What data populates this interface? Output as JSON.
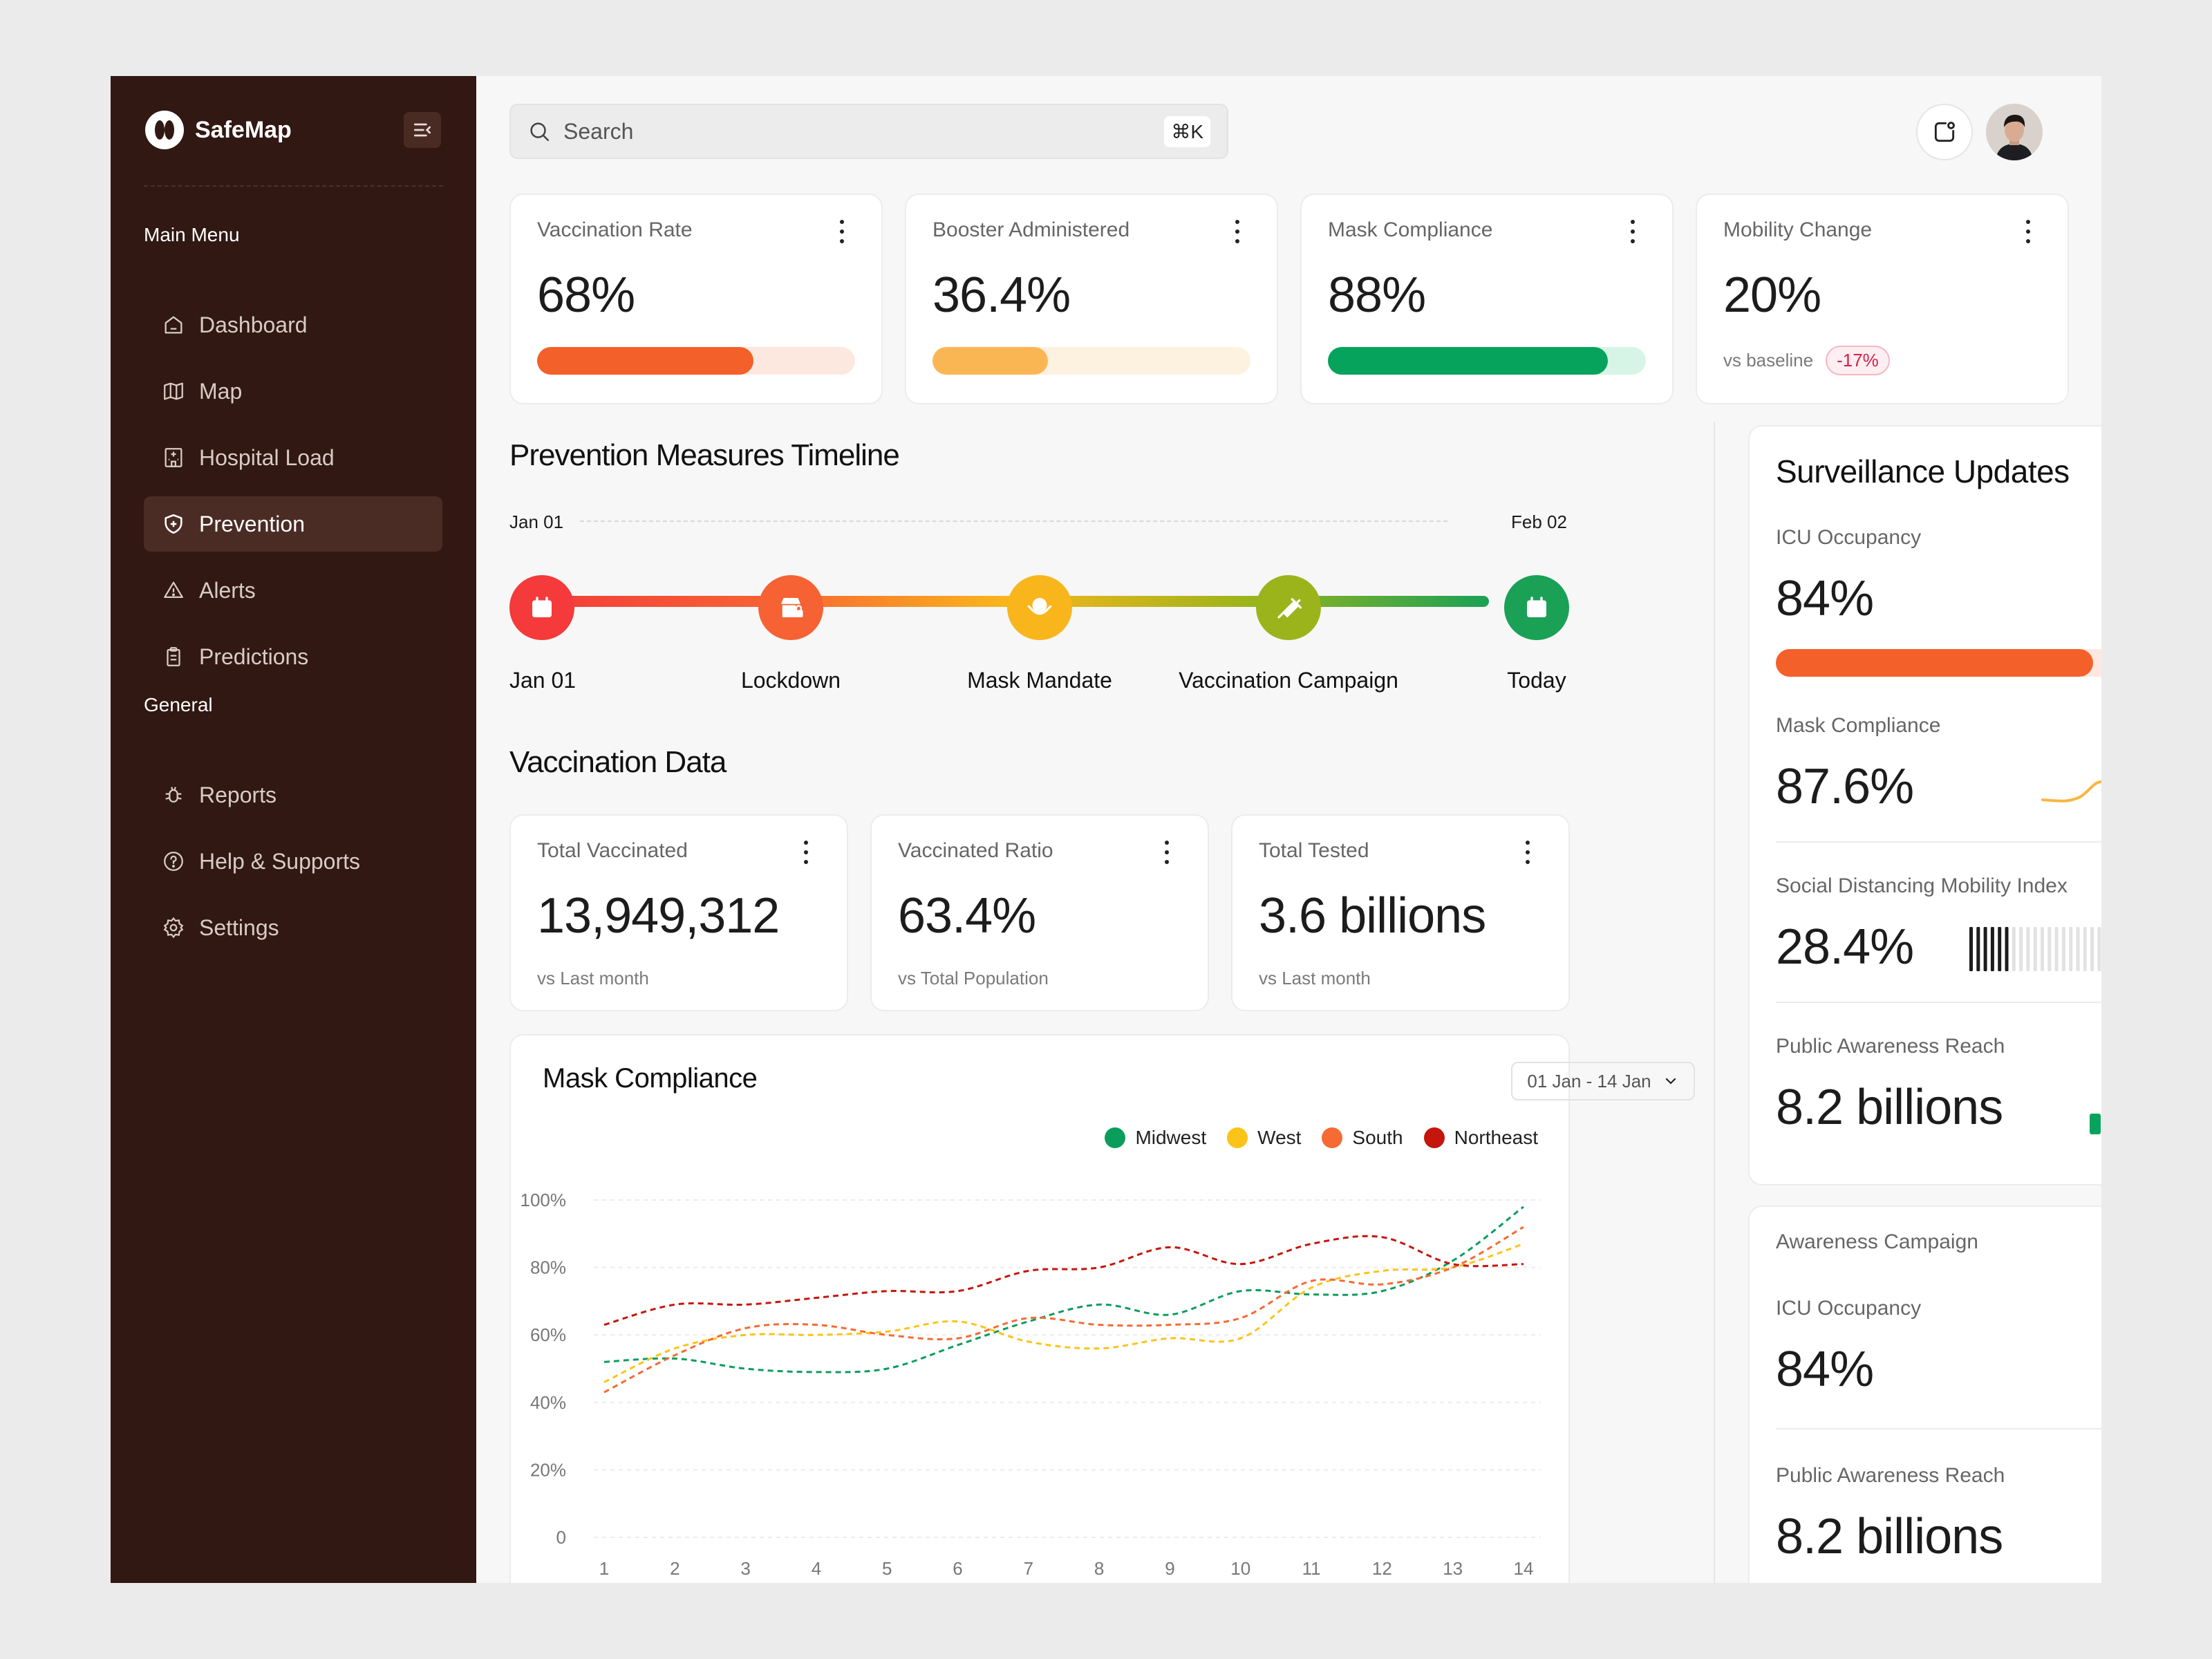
{
  "app": {
    "name": "SafeMap"
  },
  "sidebar": {
    "main_menu_label": "Main Menu",
    "main_items": [
      {
        "label": "Dashboard",
        "icon": "home-icon"
      },
      {
        "label": "Map",
        "icon": "map-icon"
      },
      {
        "label": "Hospital Load",
        "icon": "hospital-icon"
      },
      {
        "label": "Prevention",
        "icon": "shield-plus-icon",
        "active": true
      },
      {
        "label": "Alerts",
        "icon": "warning-icon"
      },
      {
        "label": "Predictions",
        "icon": "clipboard-icon"
      }
    ],
    "general_label": "General",
    "general_items": [
      {
        "label": "Reports",
        "icon": "bug-icon"
      },
      {
        "label": "Help & Supports",
        "icon": "help-icon"
      },
      {
        "label": "Settings",
        "icon": "gear-icon"
      }
    ]
  },
  "search": {
    "placeholder": "Search",
    "shortcut": "⌘K"
  },
  "stats": [
    {
      "title": "Vaccination Rate",
      "value": "68%",
      "progress": 0.68,
      "color": "#f4602a",
      "track": "#fde8df"
    },
    {
      "title": "Booster Administered",
      "value": "36.4%",
      "progress": 0.364,
      "color": "#fbb654",
      "track": "#fdf1e0"
    },
    {
      "title": "Mask Compliance",
      "value": "88%",
      "progress": 0.88,
      "color": "#05a35c",
      "track": "#d7f5e7"
    },
    {
      "title": "Mobility Change",
      "value": "20%",
      "sub": "vs baseline",
      "badge": "-17%"
    }
  ],
  "timeline": {
    "title": "Prevention Measures Timeline",
    "start_date": "Jan 01",
    "end_date": "Feb 02",
    "events": [
      {
        "label": "Jan 01",
        "color": "#f43a3a",
        "icon": "calendar-icon"
      },
      {
        "label": "Lockdown",
        "color": "#f66234",
        "icon": "store-lock-icon"
      },
      {
        "label": "Mask Mandate",
        "color": "#f8b61c",
        "icon": "mask-icon"
      },
      {
        "label": "Vaccination Campaign",
        "color": "#9cb41c",
        "icon": "syringe-icon"
      },
      {
        "label": "Today",
        "color": "#1aa156",
        "icon": "calendar-icon"
      }
    ]
  },
  "vaccination": {
    "title": "Vaccination Data",
    "cards": [
      {
        "title": "Total Vaccinated",
        "value": "13,949,312",
        "sub": "vs Last month"
      },
      {
        "title": "Vaccinated Ratio",
        "value": "63.4%",
        "sub": "vs Total Population"
      },
      {
        "title": "Total Tested",
        "value": "3.6 billions",
        "sub": "vs Last month"
      }
    ]
  },
  "mask_chart": {
    "title": "Mask Compliance",
    "date_range": "01 Jan - 14 Jan"
  },
  "chart_data": {
    "type": "line",
    "title": "Mask Compliance",
    "x": [
      1,
      2,
      3,
      4,
      5,
      6,
      7,
      8,
      9,
      10,
      11,
      12,
      13,
      14
    ],
    "ylim": [
      0,
      100
    ],
    "y_ticks": [
      "0",
      "20%",
      "40%",
      "60%",
      "80%",
      "100%"
    ],
    "legend_position": "top-right",
    "grid": true,
    "series": [
      {
        "name": "Midwest",
        "color": "#0a9d5c",
        "values": [
          52,
          53,
          50,
          49,
          50,
          57,
          64,
          69,
          66,
          73,
          72,
          73,
          82,
          98
        ]
      },
      {
        "name": "West",
        "color": "#fcc419",
        "values": [
          46,
          56,
          60,
          60,
          61,
          64,
          58,
          56,
          59,
          59,
          74,
          79,
          80,
          87
        ]
      },
      {
        "name": "South",
        "color": "#f66a34",
        "values": [
          43,
          54,
          62,
          63,
          60,
          59,
          65,
          63,
          63,
          65,
          76,
          75,
          80,
          92
        ]
      },
      {
        "name": "Northeast",
        "color": "#c4160c",
        "values": [
          63,
          69,
          69,
          71,
          73,
          73,
          79,
          80,
          86,
          81,
          87,
          89,
          81,
          81
        ]
      }
    ]
  },
  "surveillance": {
    "title": "Surveillance Updates",
    "icu_label": "ICU Occupancy",
    "icu_value": "84%",
    "icu_progress": 0.84,
    "mask_label": "Mask Compliance",
    "mask_value": "87.6%",
    "mobility_label": "Social Distancing Mobility Index",
    "mobility_value": "28.4%",
    "mobility_level": 0.28,
    "awareness_label": "Public Awareness Reach",
    "awareness_value": "8.2 billions"
  },
  "campaign": {
    "title": "Awareness Campaign",
    "icu_label": "ICU Occupancy",
    "icu_value": "84%",
    "awareness_label": "Public Awareness Reach",
    "awareness_value": "8.2 billions"
  }
}
